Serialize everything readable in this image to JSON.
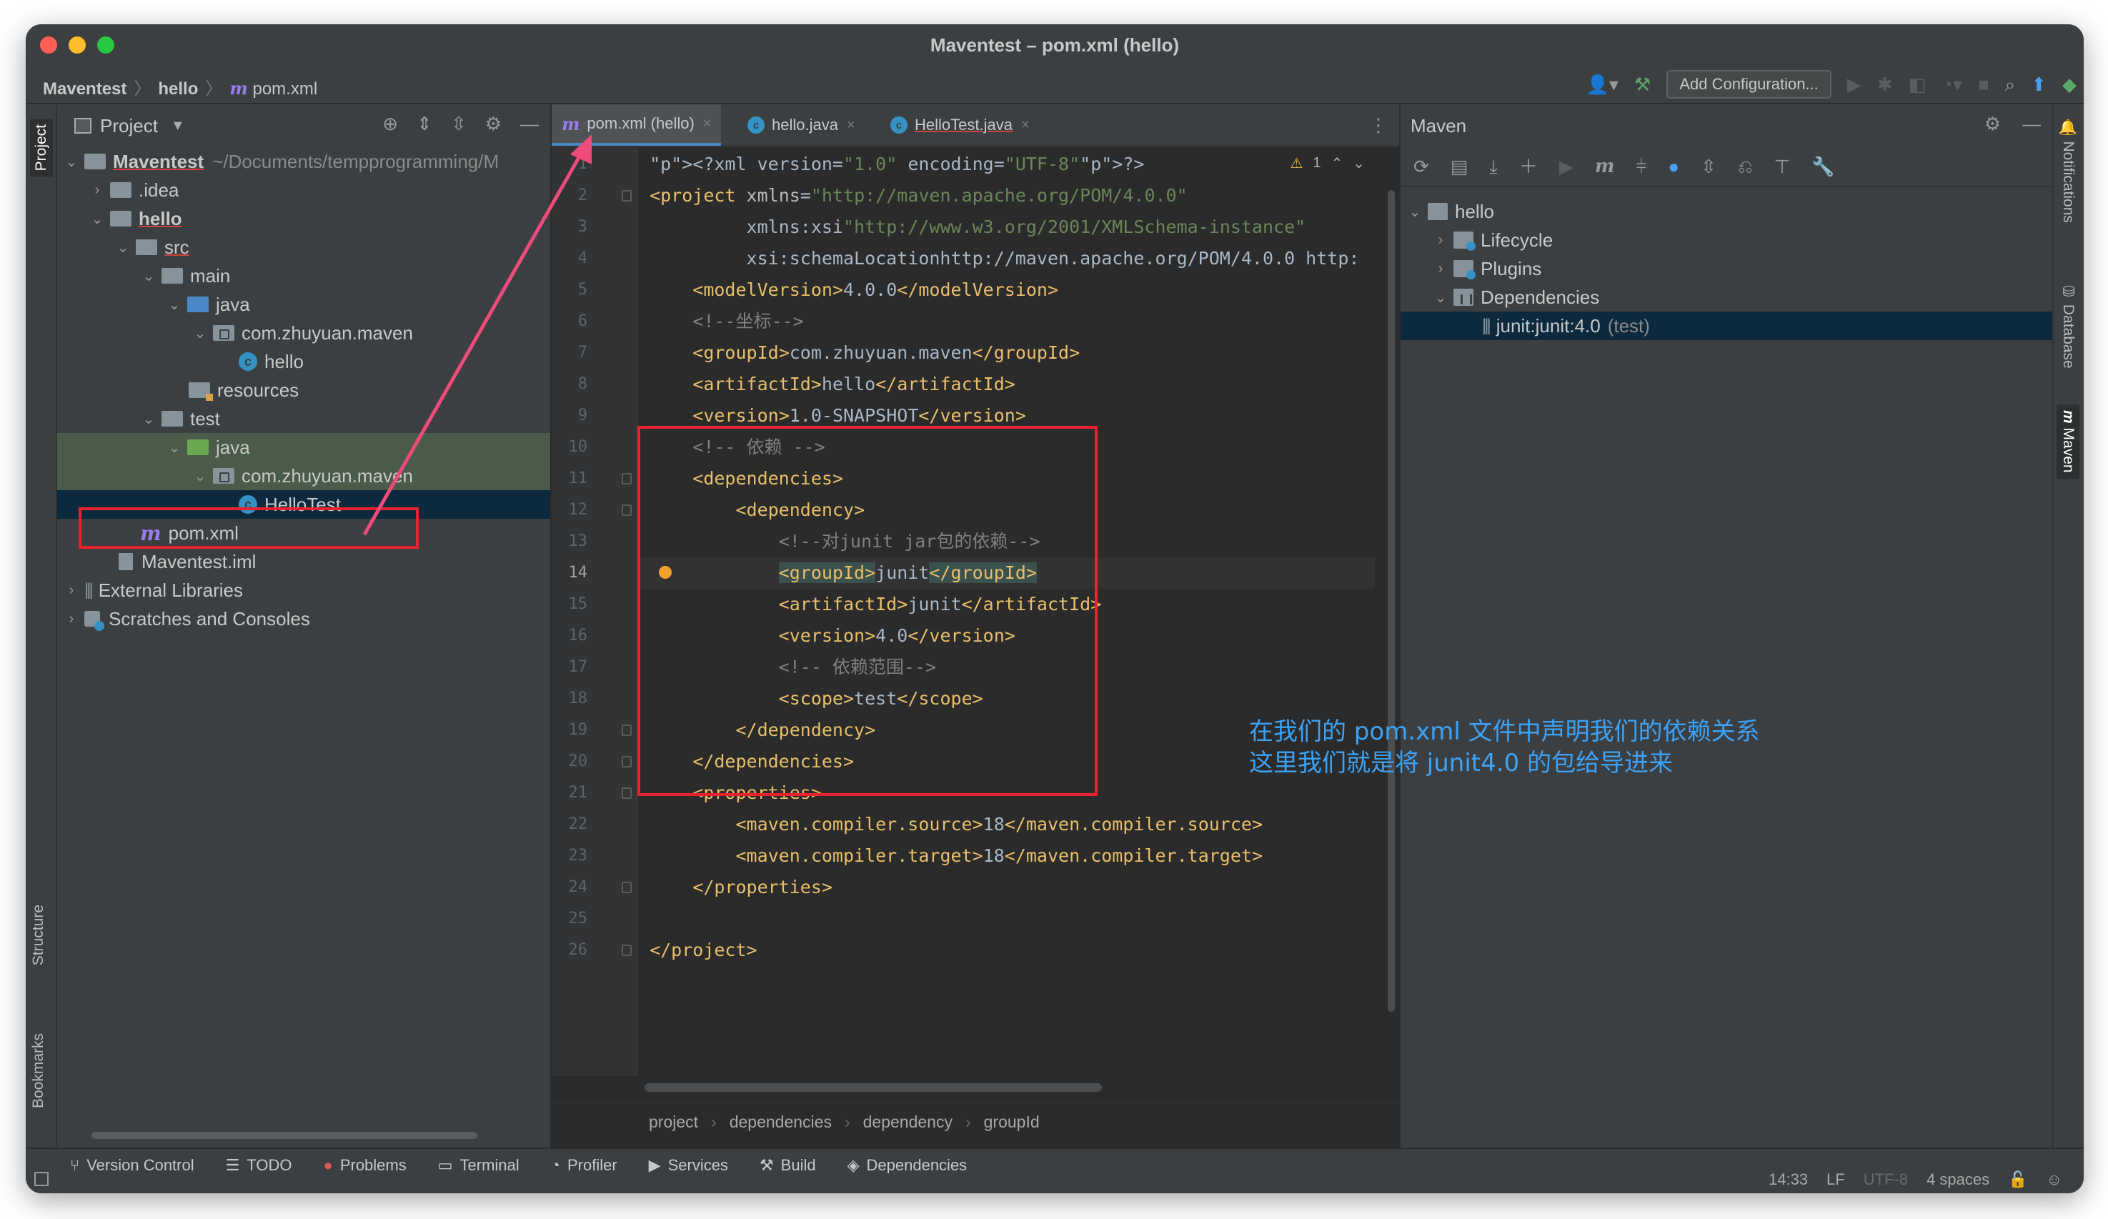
{
  "window": {
    "title": "Maventest – pom.xml (hello)"
  },
  "navbar": {
    "crumbs": [
      "Maventest",
      "hello",
      "pom.xml"
    ],
    "add_configuration": "Add Configuration..."
  },
  "left_stripe": {
    "project": "Project",
    "structure": "Structure",
    "bookmarks": "Bookmarks"
  },
  "right_stripe": {
    "notifications": "Notifications",
    "database": "Database",
    "maven": "Maven"
  },
  "project_panel": {
    "title": "Project",
    "tree": [
      {
        "label": "Maventest",
        "path": "~/Documents/tempprogramming/M"
      },
      {
        "label": ".idea"
      },
      {
        "label": "hello"
      },
      {
        "label": "src"
      },
      {
        "label": "main"
      },
      {
        "label": "java"
      },
      {
        "label": "com.zhuyuan.maven"
      },
      {
        "label": "hello"
      },
      {
        "label": "resources"
      },
      {
        "label": "test"
      },
      {
        "label": "java"
      },
      {
        "label": "com.zhuyuan.maven"
      },
      {
        "label": "HelloTest"
      },
      {
        "label": "pom.xml"
      },
      {
        "label": "Maventest.iml"
      },
      {
        "label": "External Libraries"
      },
      {
        "label": "Scratches and Consoles"
      }
    ]
  },
  "editor": {
    "tabs": [
      {
        "label": "pom.xml (hello)"
      },
      {
        "label": "hello.java"
      },
      {
        "label": "HelloTest.java"
      }
    ],
    "warning_count": "1",
    "current_line": 14,
    "code": [
      "<?xml version=\"1.0\" encoding=\"UTF-8\"?>",
      "<project xmlns=\"http://maven.apache.org/POM/4.0.0\"",
      "         xmlns:xsi=\"http://www.w3.org/2001/XMLSchema-instance\"",
      "         xsi:schemaLocation=\"http://maven.apache.org/POM/4.0.0 http:",
      "    <modelVersion>4.0.0</modelVersion>",
      "    <!--坐标-->",
      "    <groupId>com.zhuyuan.maven</groupId>",
      "    <artifactId>hello</artifactId>",
      "    <version>1.0-SNAPSHOT</version>",
      "    <!-- 依赖 -->",
      "    <dependencies>",
      "        <dependency>",
      "            <!--对junit jar包的依赖-->",
      "            <groupId>junit</groupId>",
      "            <artifactId>junit</artifactId>",
      "            <version>4.0</version>",
      "            <!-- 依赖范围-->",
      "            <scope>test</scope>",
      "        </dependency>",
      "    </dependencies>",
      "    <properties>",
      "        <maven.compiler.source>18</maven.compiler.source>",
      "        <maven.compiler.target>18</maven.compiler.target>",
      "    </properties>",
      "",
      "</project>"
    ],
    "breadcrumbs": [
      "project",
      "dependencies",
      "dependency",
      "groupId"
    ]
  },
  "maven_panel": {
    "title": "Maven",
    "tree": [
      {
        "label": "hello"
      },
      {
        "label": "Lifecycle"
      },
      {
        "label": "Plugins"
      },
      {
        "label": "Dependencies"
      },
      {
        "label": "junit:junit:4.0",
        "scope": "(test)"
      }
    ]
  },
  "annotation": {
    "note_line1": "在我们的 pom.xml 文件中声明我们的依赖关系",
    "note_line2": "这里我们就是将 junit4.0 的包给导进来",
    "color": "#e8222e"
  },
  "toolwindows": [
    "Version Control",
    "TODO",
    "Problems",
    "Terminal",
    "Profiler",
    "Services",
    "Build",
    "Dependencies"
  ],
  "status": {
    "position": "14:33",
    "line_sep": "LF",
    "encoding": "UTF-8",
    "indent": "4 spaces"
  }
}
